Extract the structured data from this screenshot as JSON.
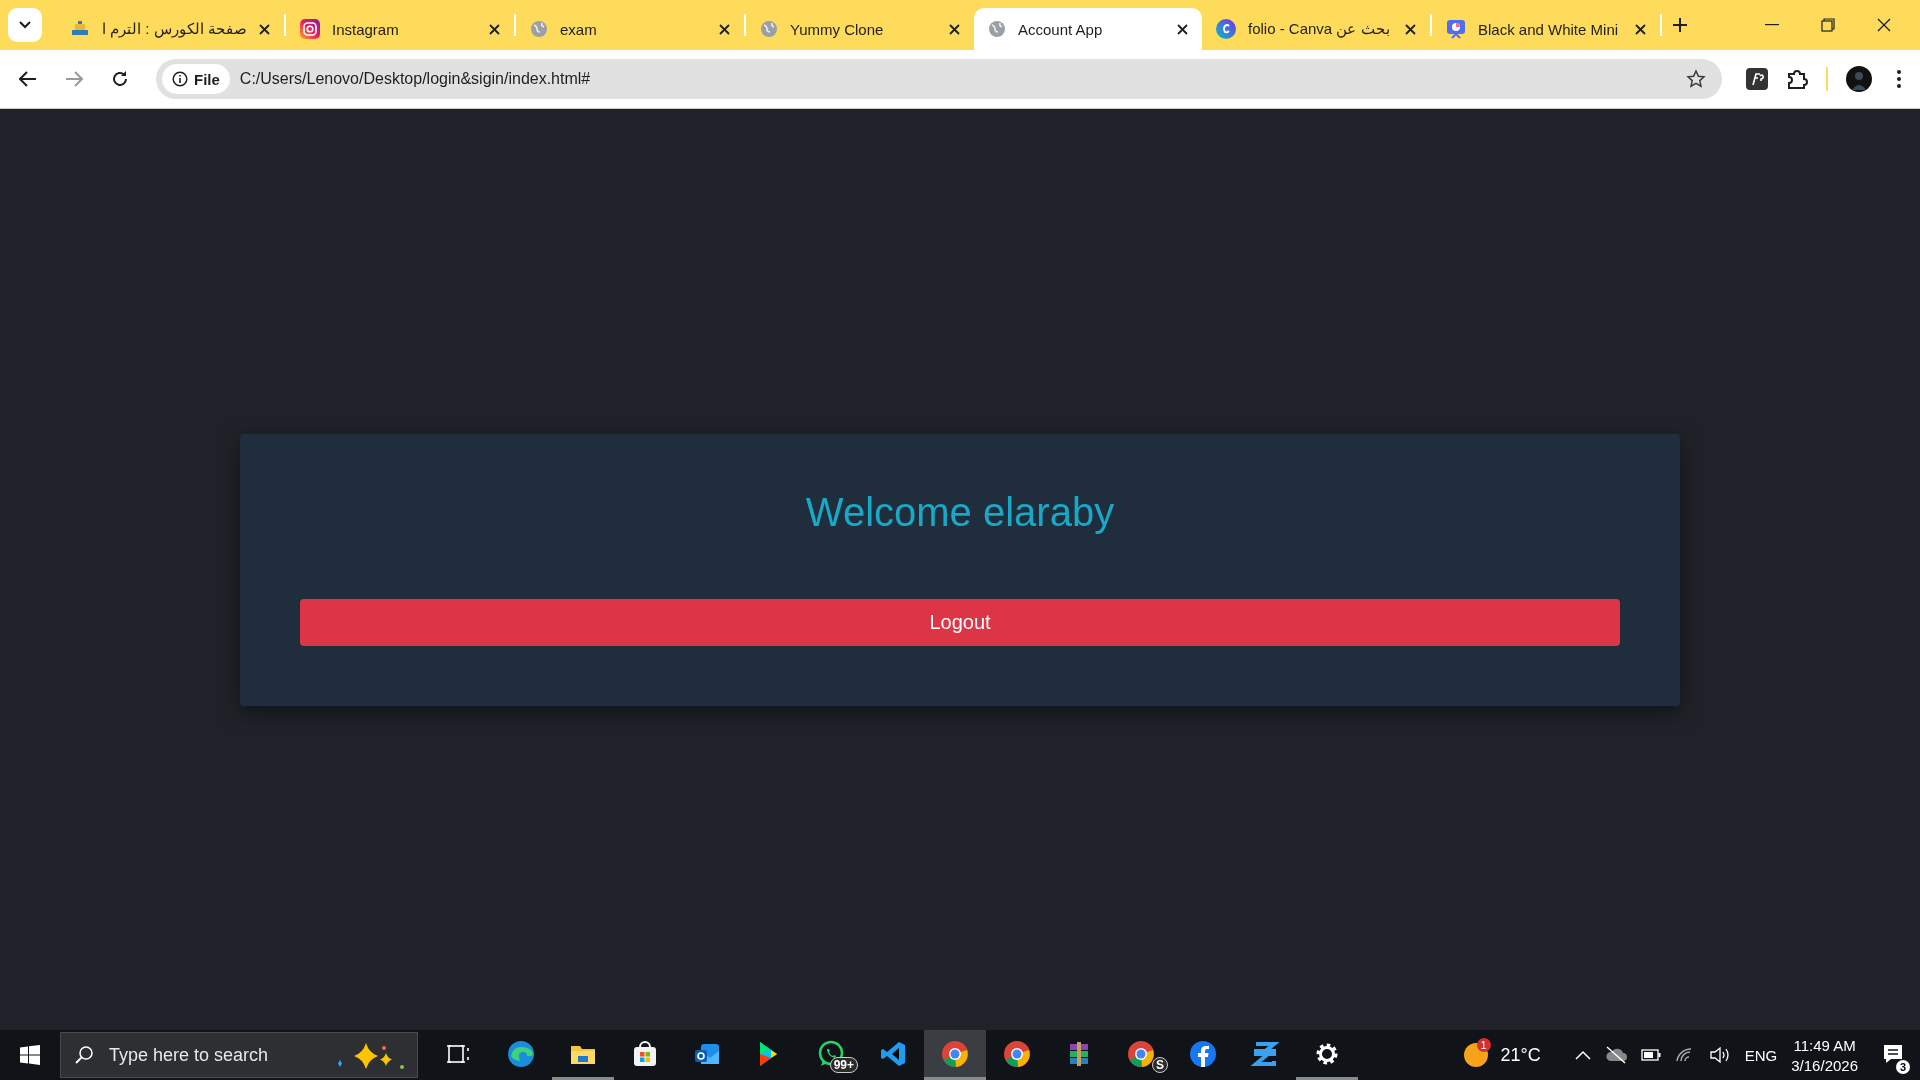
{
  "browser": {
    "tabs": [
      {
        "title": "صفحة الكورس : الترم ا",
        "kind": "site",
        "selected": false
      },
      {
        "title": "Instagram",
        "kind": "instagram",
        "selected": false
      },
      {
        "title": "exam",
        "kind": "globe",
        "selected": false
      },
      {
        "title": "Yummy Clone",
        "kind": "globe",
        "selected": false
      },
      {
        "title": "Account App",
        "kind": "globe",
        "selected": true
      },
      {
        "title": "بحث عن folio - Canva",
        "kind": "canva",
        "selected": false
      },
      {
        "title": "Black and White Mini",
        "kind": "slides",
        "selected": false
      }
    ],
    "address": {
      "scheme": "File",
      "url": "C:/Users/Lenovo/Desktop/login&sigin/index.html#"
    }
  },
  "page": {
    "heading": "Welcome elaraby",
    "button": "Logout"
  },
  "taskbar": {
    "search": {
      "placeholder": "Type here to search"
    },
    "apps": [
      {
        "kind": "taskview",
        "running": false,
        "selected": false
      },
      {
        "kind": "edge",
        "running": false,
        "selected": false
      },
      {
        "kind": "folder",
        "running": true,
        "selected": false
      },
      {
        "kind": "store",
        "running": false,
        "selected": false
      },
      {
        "kind": "mail",
        "running": false,
        "selected": false
      },
      {
        "kind": "play",
        "running": false,
        "selected": false
      },
      {
        "kind": "chat",
        "running": false,
        "selected": false,
        "badge": "99+"
      },
      {
        "kind": "code",
        "running": false,
        "selected": false
      },
      {
        "kind": "chrome",
        "running": true,
        "selected": true
      },
      {
        "kind": "chrome",
        "running": false,
        "selected": false
      },
      {
        "kind": "archive",
        "running": false,
        "selected": false
      },
      {
        "kind": "chrome",
        "running": false,
        "selected": false,
        "badge": "S"
      },
      {
        "kind": "facebook",
        "running": false,
        "selected": false
      },
      {
        "kind": "stack",
        "running": false,
        "selected": false
      },
      {
        "kind": "gear",
        "running": true,
        "selected": false
      }
    ],
    "weather": {
      "badge": "1",
      "temperature": "21°C"
    },
    "language": "ENG",
    "time": "11:49 AM",
    "date": "3/16/2026",
    "notifications": "3"
  }
}
